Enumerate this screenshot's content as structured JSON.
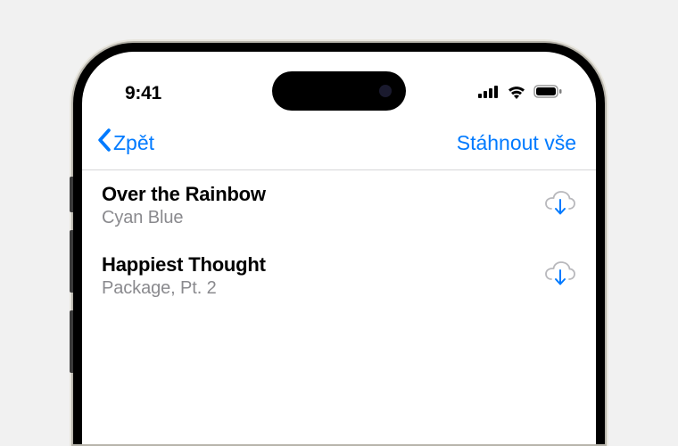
{
  "status": {
    "time": "9:41"
  },
  "nav": {
    "back_label": "Zpět",
    "action_label": "Stáhnout vše"
  },
  "songs": [
    {
      "title": "Over the Rainbow",
      "subtitle": "Cyan Blue"
    },
    {
      "title": "Happiest Thought",
      "subtitle": "Package, Pt. 2"
    }
  ],
  "colors": {
    "accent": "#007aff",
    "secondary_text": "#8a8a8e"
  }
}
